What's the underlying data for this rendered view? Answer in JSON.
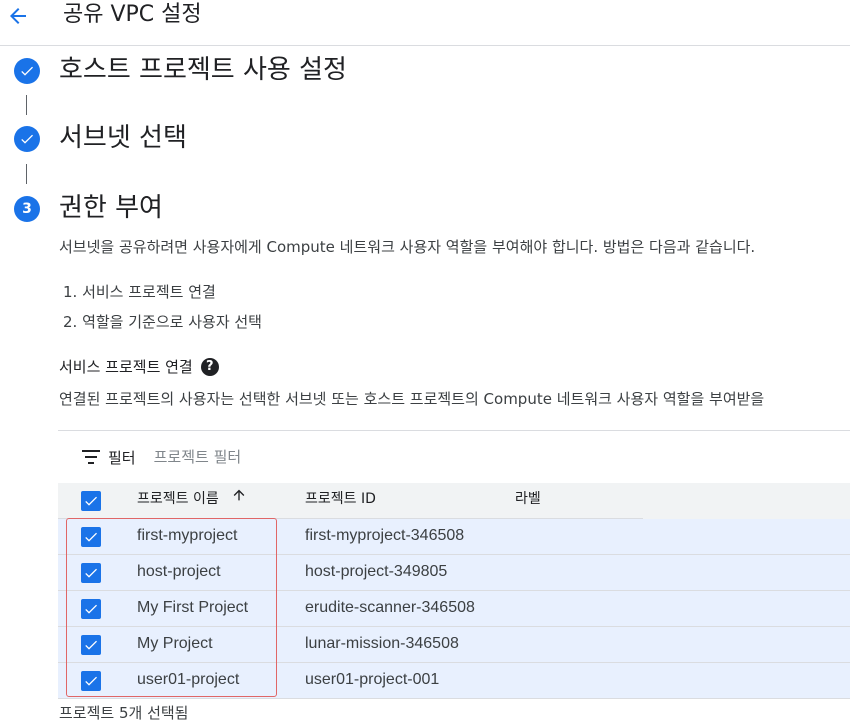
{
  "header": {
    "title": "공유 VPC 설정"
  },
  "steps": [
    {
      "title": "호스트 프로젝트 사용 설정",
      "status": "complete"
    },
    {
      "title": "서브넷 선택",
      "status": "complete"
    },
    {
      "title": "권한 부여",
      "status": "current",
      "number": "3"
    }
  ],
  "description": "서브넷을 공유하려면 사용자에게 Compute 네트워크 사용자 역할을 부여해야 합니다. 방법은 다음과 같습니다.",
  "instructions": [
    "1.  서비스 프로젝트 연결",
    "2.  역할을 기준으로 사용자 선택"
  ],
  "section": {
    "title": "서비스 프로젝트 연결",
    "help_icon": "help-icon",
    "description": "연결된 프로젝트의 사용자는 선택한 서브넷 또는 호스트 프로젝트의 Compute 네트워크 사용자 역할을 부여받을"
  },
  "table": {
    "filter_label": "필터",
    "filter_placeholder": "프로젝트 필터",
    "columns": {
      "name": "프로젝트 이름",
      "id": "프로젝트 ID",
      "labels": "라벨"
    },
    "sort": "ascending",
    "rows": [
      {
        "name": "first-myproject",
        "id": "first-myproject-346508",
        "checked": true
      },
      {
        "name": "host-project",
        "id": "host-project-349805",
        "checked": true
      },
      {
        "name": "My First Project",
        "id": "erudite-scanner-346508",
        "checked": true
      },
      {
        "name": "My Project",
        "id": "lunar-mission-346508",
        "checked": true
      },
      {
        "name": "user01-project",
        "id": "user01-project-001",
        "checked": true
      }
    ],
    "selected_text": "프로젝트 5개 선택됨"
  },
  "colors": {
    "accent": "#1a73e8",
    "row_selected": "#e8f0fe",
    "highlight": "#e06666"
  }
}
